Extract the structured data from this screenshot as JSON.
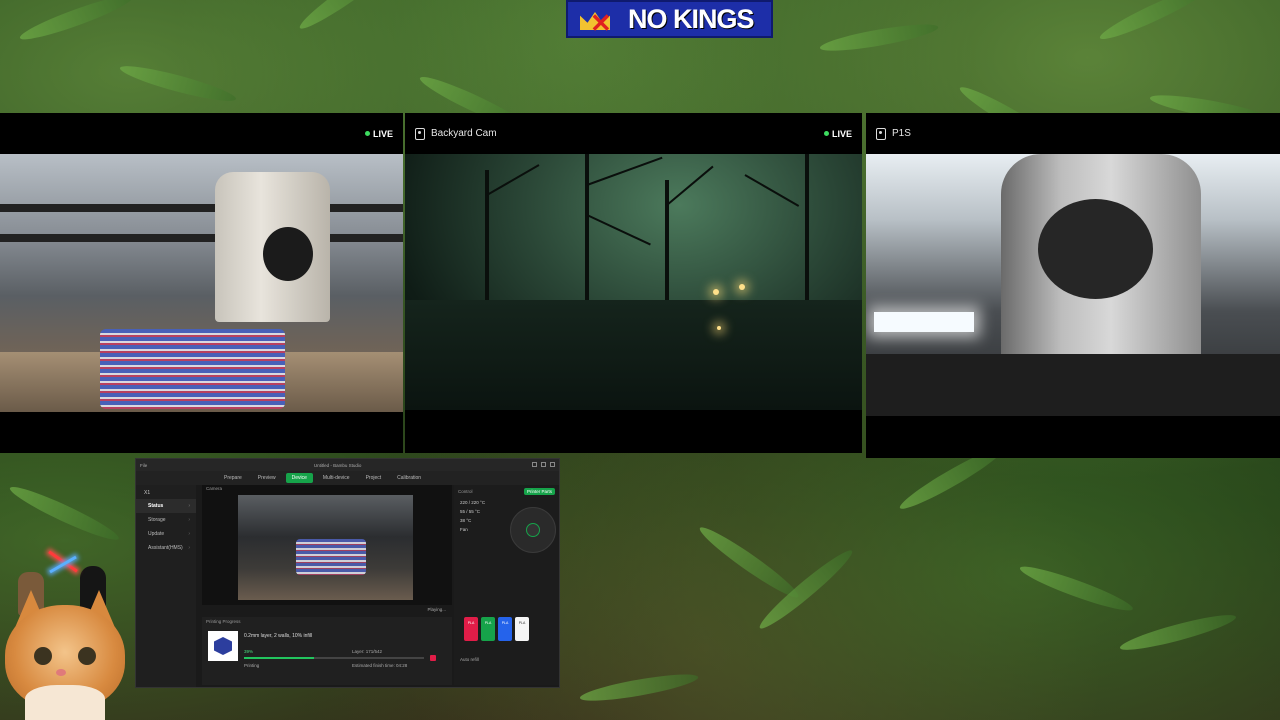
{
  "banner": {
    "text": "NO KINGS"
  },
  "cameras": [
    {
      "name": "",
      "live_label": "LIVE"
    },
    {
      "name": "Backyard Cam",
      "live_label": "LIVE"
    },
    {
      "name": "P1S",
      "live_label": ""
    }
  ],
  "studio": {
    "window_title": "Untitled - Bambu Studio",
    "tabs": [
      {
        "label": "Home"
      },
      {
        "label": "Prepare"
      },
      {
        "label": "Preview"
      },
      {
        "label": "Device"
      },
      {
        "label": "Multi-device"
      },
      {
        "label": "Project"
      },
      {
        "label": "Calibration"
      }
    ],
    "printer_name": "X1",
    "sidebar": [
      "Status",
      "Storage",
      "Update",
      "Assistant(HMS)"
    ],
    "camera_header": "Camera",
    "play_status": "Playing...",
    "progress_header": "Printing Progress",
    "print_name": "0.2mm layer, 2 walls, 10% infill",
    "percent": "39%",
    "layer": "Layer: 171/542",
    "status": "Printing",
    "eta": "Estimated finish time: 04:28",
    "progress_value": 0.39,
    "control_header": "Control",
    "printer_parts": "Printer Parts",
    "temps": [
      "220 / 220 °C",
      "55 / 55 °C",
      "38 °C"
    ],
    "fan_label": "Fan",
    "spools": [
      {
        "label": "PLA",
        "color": "#e11d48"
      },
      {
        "label": "PLA",
        "color": "#16a34a"
      },
      {
        "label": "PLA",
        "color": "#2563eb"
      },
      {
        "label": "PLA",
        "color": "#f5f5f5"
      }
    ],
    "ams_label": "Auto refill"
  },
  "colors": {
    "accent": "#16a34a",
    "live_dot": "#3ddc60"
  }
}
